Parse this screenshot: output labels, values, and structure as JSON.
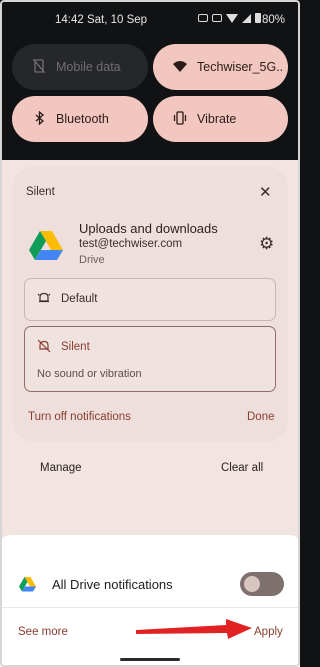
{
  "status_bar": {
    "time_date": "14:42 Sat, 10 Sep",
    "battery": "80%"
  },
  "quick_settings": {
    "tiles": [
      {
        "label": "Mobile data",
        "icon": "mobile-data-off-icon",
        "state": "off"
      },
      {
        "label": "Techwiser_5G..",
        "icon": "wifi-icon",
        "state": "on"
      },
      {
        "label": "Bluetooth",
        "icon": "bluetooth-icon",
        "state": "on"
      },
      {
        "label": "Vibrate",
        "icon": "vibrate-icon",
        "state": "on"
      }
    ]
  },
  "channel_panel": {
    "title": "Silent",
    "channel_name": "Uploads and downloads",
    "account": "test@techwiser.com",
    "app": "Drive",
    "options": {
      "default_label": "Default",
      "silent_label": "Silent",
      "silent_description": "No sound or vibration"
    },
    "turn_off_label": "Turn off notifications",
    "done_label": "Done"
  },
  "notification_actions": {
    "manage_label": "Manage",
    "clear_all_label": "Clear all"
  },
  "bottom_sheet": {
    "label": "All Drive notifications",
    "toggle_on": false,
    "see_more_label": "See more",
    "apply_label": "Apply"
  },
  "colors": {
    "accent": "#8a3d2f",
    "tile_on": "#f2c7bf",
    "annotation_arrow": "#e02222"
  }
}
